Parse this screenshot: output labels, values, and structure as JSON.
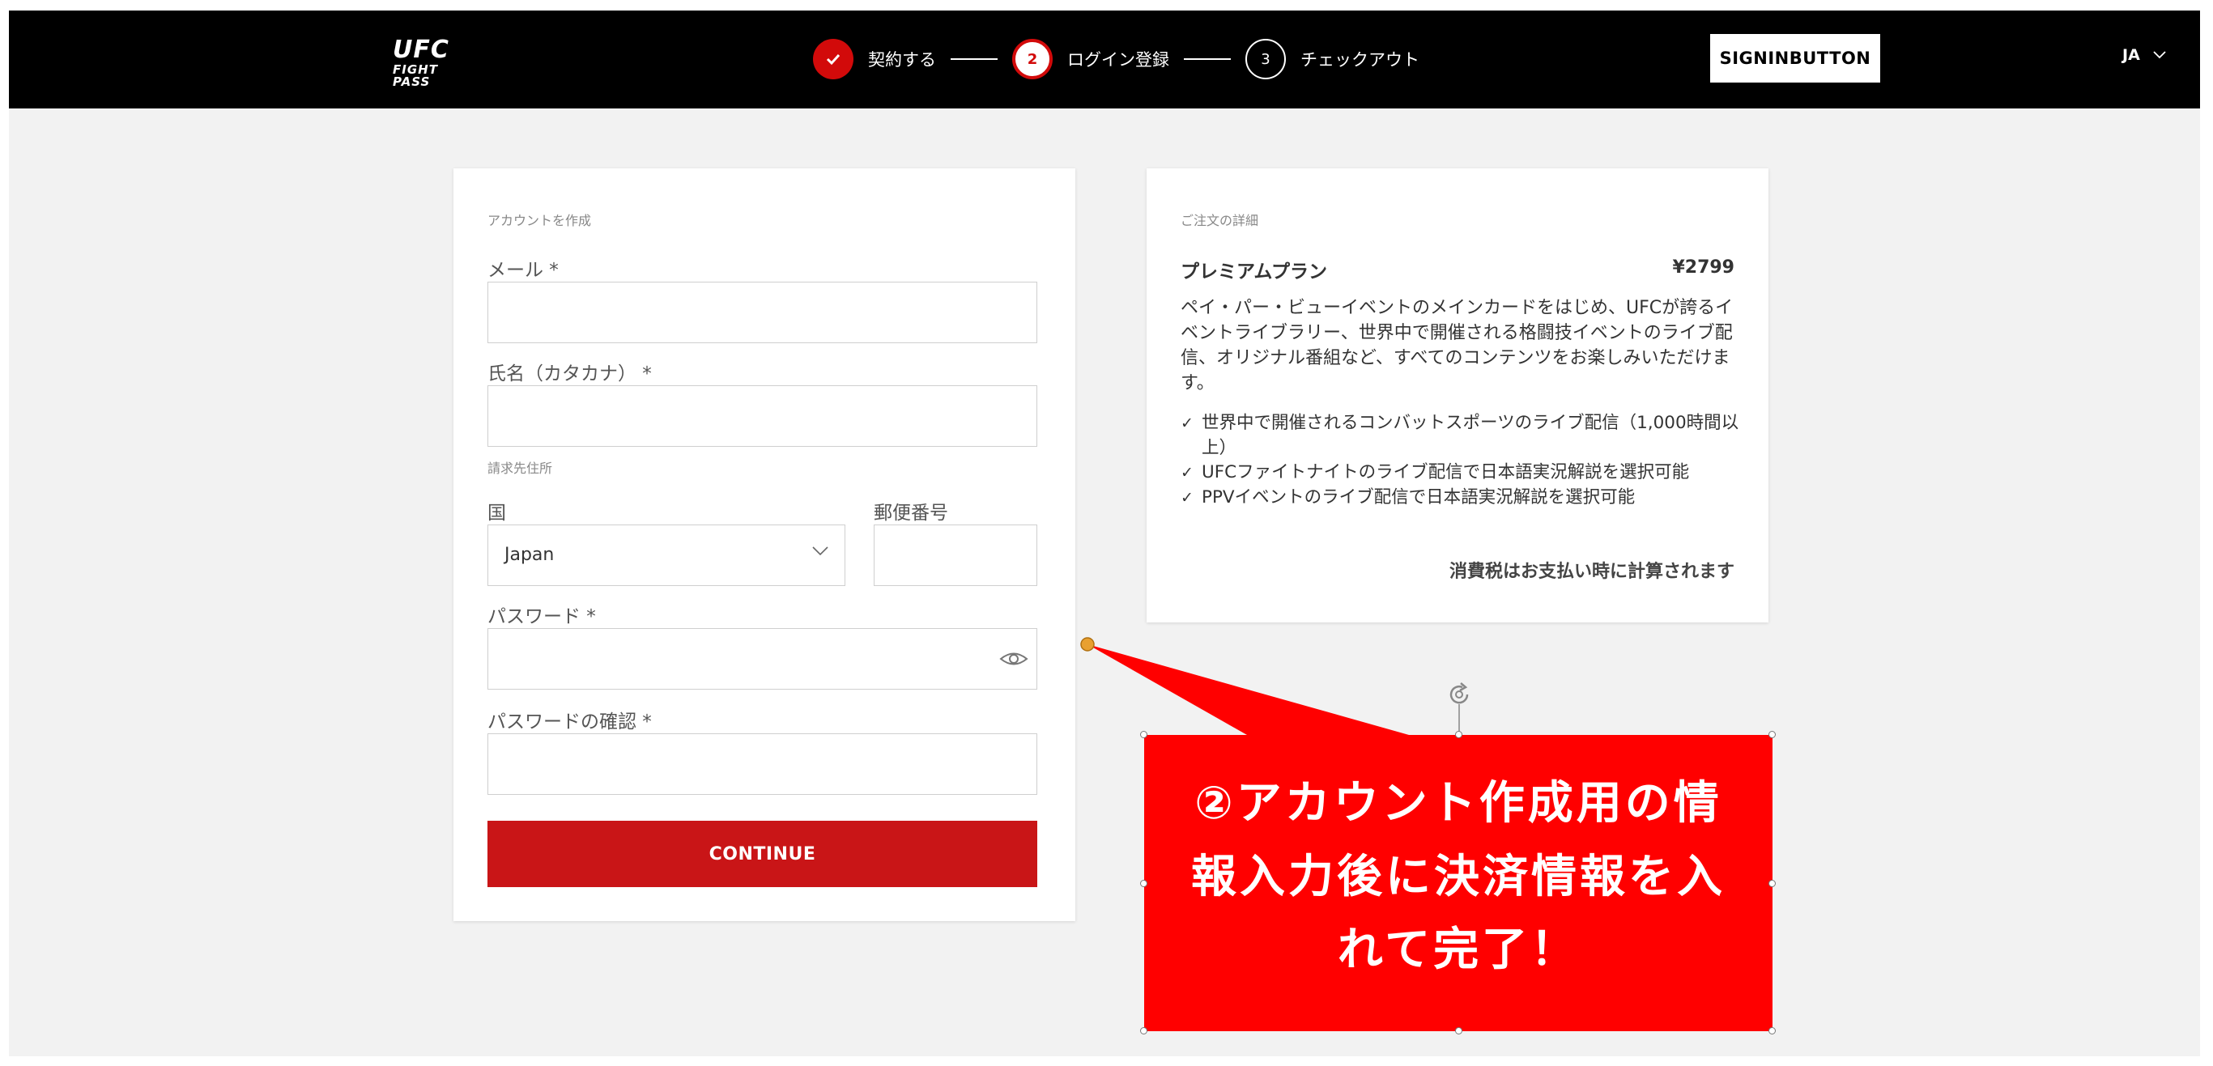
{
  "header": {
    "logo_line1": "UFC",
    "logo_line2": "FIGHT PASS",
    "steps": [
      {
        "number": "✓",
        "label": "契約する",
        "state": "done"
      },
      {
        "number": "2",
        "label": "ログイン登録",
        "state": "active"
      },
      {
        "number": "3",
        "label": "チェックアウト",
        "state": "todo"
      }
    ],
    "signin_label": "SIGNINBUTTON",
    "language": "JA"
  },
  "form": {
    "heading": "アカウントを作成",
    "email_label": "メール *",
    "email_value": "",
    "name_label": "氏名（カタカナ） *",
    "name_value": "",
    "billing_heading": "請求先住所",
    "country_label": "国",
    "country_value": "Japan",
    "postal_label": "郵便番号",
    "postal_value": "",
    "password_label": "パスワード *",
    "password_value": "",
    "confirm_label": "パスワードの確認 *",
    "confirm_value": "",
    "continue_label": "CONTINUE"
  },
  "order": {
    "heading": "ご注文の詳細",
    "plan_name": "プレミアムプラン",
    "plan_price": "¥2799",
    "description": "ペイ・パー・ビューイベントのメインカードをはじめ、UFCが誇るイベントライブラリー、世界中で開催される格闘技イベントのライブ配信、オリジナル番組など、すべてのコンテンツをお楽しみいただけます。",
    "benefits": [
      "世界中で開催されるコンバットスポーツのライブ配信（1,000時間以上）",
      "UFCファイトナイトのライブ配信で日本語実況解説を選択可能",
      "PPVイベントのライブ配信で日本語実況解説を選択可能"
    ],
    "tax_note": "消費税はお支払い時に計算されます"
  },
  "callout": {
    "lines": [
      "②アカウント作成用の情",
      "報入力後に決済情報を入",
      "れて完了！"
    ]
  },
  "colors": {
    "brand_red": "#d20a0a",
    "button_red": "#c91517",
    "callout_red": "#ff0000"
  }
}
